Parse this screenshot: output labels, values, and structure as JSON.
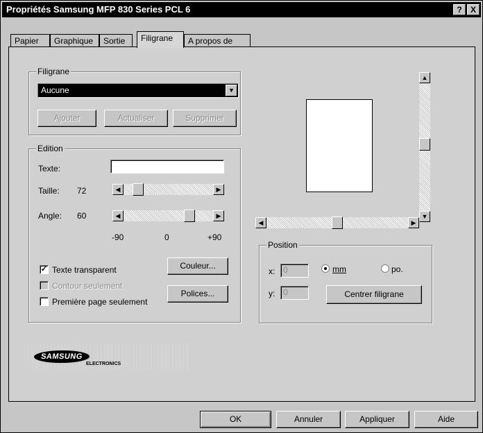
{
  "window": {
    "title": "Propriétés Samsung MFP 830 Series PCL 6",
    "help_btn": "?",
    "close_btn": "X"
  },
  "tabs": [
    {
      "label": "Papier"
    },
    {
      "label": "Graphique"
    },
    {
      "label": "Sortie"
    },
    {
      "label": "Filigrane",
      "active": true
    },
    {
      "label": "A propos de"
    }
  ],
  "watermark_group": {
    "title": "Filigrane",
    "selected": "Aucune",
    "buttons": {
      "add": "Ajouter",
      "update": "Actualiser",
      "delete": "Supprimer"
    }
  },
  "edition_group": {
    "title": "Edition",
    "text_label": "Texte:",
    "text_value": "",
    "size_label": "Taille:",
    "size_value": "72",
    "angle_label": "Angle:",
    "angle_value": "60",
    "scale": {
      "min": "-90",
      "mid": "0",
      "max": "+90"
    },
    "transparent_text": "Texte transparent",
    "transparent_checked": true,
    "outline_only": "Contour seulement",
    "first_page_only": "Première page seulement",
    "color_btn": "Couleur...",
    "fonts_btn": "Polices..."
  },
  "position_group": {
    "title": "Position",
    "x_label": "x:",
    "x_value": "0",
    "y_label": "y:",
    "y_value": "0",
    "unit_mm": "mm",
    "unit_in": "po.",
    "selected_unit": "mm",
    "center_btn": "Centrer filigrane"
  },
  "logo": {
    "brand": "SAMSUNG",
    "sub": "ELECTRONICS"
  },
  "footer": {
    "ok": "OK",
    "cancel": "Annuler",
    "apply": "Appliquer",
    "help": "Aide"
  }
}
